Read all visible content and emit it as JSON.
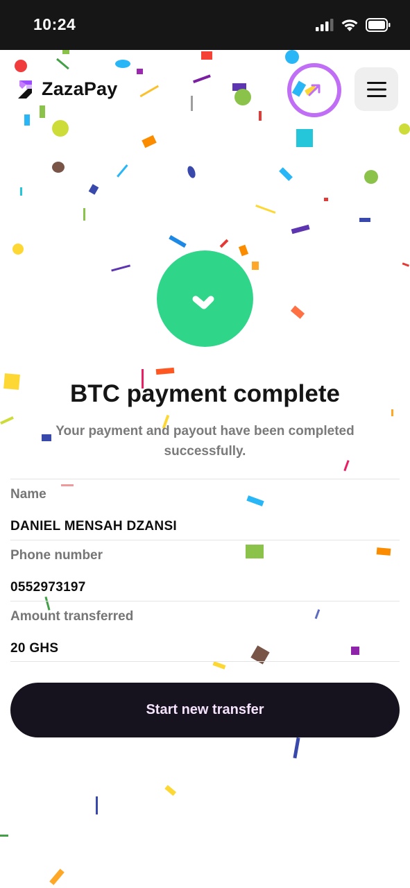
{
  "status_bar": {
    "time": "10:24",
    "icons": [
      "signal-bars-icon",
      "wifi-icon",
      "battery-icon"
    ]
  },
  "header": {
    "brand": "ZazaPay",
    "logo_icon": "zazapay-logo-icon",
    "share_icon": "share-arrow-icon",
    "menu_icon": "hamburger-menu-icon",
    "highlight_color": "#c06ef5"
  },
  "result": {
    "icon": "check-icon",
    "icon_color": "#2fd68a",
    "title": "BTC payment complete",
    "subtitle": "Your payment and payout have been completed successfully."
  },
  "details": [
    {
      "label": "Name",
      "value": "DANIEL MENSAH DZANSI"
    },
    {
      "label": "Phone number",
      "value": "0552973197"
    },
    {
      "label": "Amount transferred",
      "value": "20 GHS"
    }
  ],
  "actions": {
    "primary_label": "Start new transfer"
  }
}
